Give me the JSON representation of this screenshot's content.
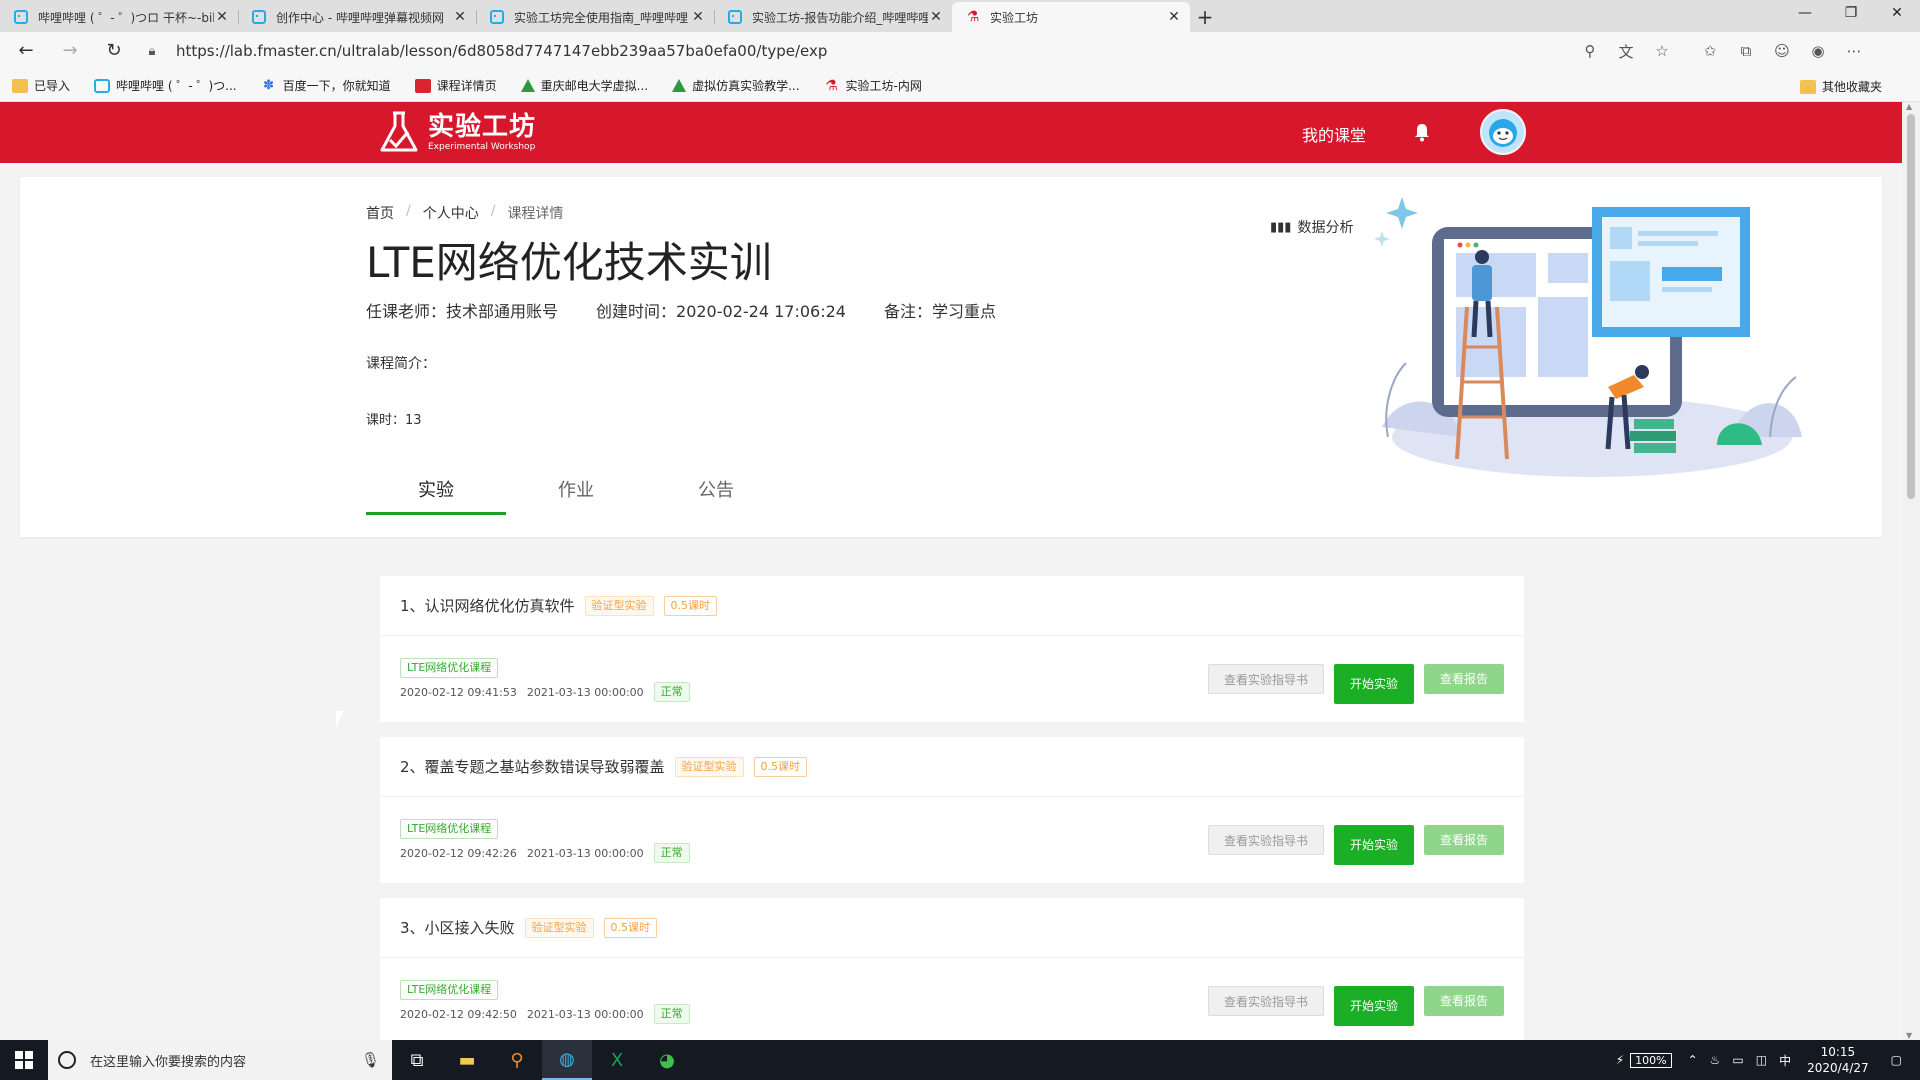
{
  "browser": {
    "tabs": [
      {
        "title": "哔哩哔哩 ( ゜- ゜)つロ 干杯~-bili",
        "icon": "bilibili-icon"
      },
      {
        "title": "创作中心 - 哔哩哔哩弹幕视频网",
        "icon": "bilibili-icon"
      },
      {
        "title": "实验工坊完全使用指南_哔哩哔哩",
        "icon": "bilibili-icon"
      },
      {
        "title": "实验工坊-报告功能介绍_哔哩哔哩",
        "icon": "bilibili-icon"
      },
      {
        "title": "实验工坊",
        "icon": "lab-icon"
      }
    ],
    "url": "https://lab.fmaster.cn/ultralab/lesson/6d8058d7747147ebb239aa57ba0efa00/type/exp",
    "bookmarks": [
      {
        "label": "已导入",
        "icon": "folder-icon"
      },
      {
        "label": "哔哩哔哩 ( ゜- ゜)つ...",
        "icon": "bilibili-icon"
      },
      {
        "label": "百度一下，你就知道",
        "icon": "baidu-icon"
      },
      {
        "label": "课程详情页",
        "icon": "red-app-icon"
      },
      {
        "label": "重庆邮电大学虚拟...",
        "icon": "triangle-icon"
      },
      {
        "label": "虚拟仿真实验教学...",
        "icon": "triangle-icon"
      },
      {
        "label": "实验工坊-内网",
        "icon": "lab-icon"
      }
    ],
    "other_bookmarks": "其他收藏夹"
  },
  "site": {
    "logo_cn": "实验工坊",
    "logo_en": "Experimental Workshop",
    "my_class": "我的课堂",
    "brand_color": "#d6172c"
  },
  "course": {
    "breadcrumb": [
      "首页",
      "个人中心",
      "课程详情"
    ],
    "title": "LTE网络优化技术实训",
    "teacher": "任课老师：技术部通用账号",
    "created": "创建时间：2020-02-24 17:06:24",
    "note": "备注：学习重点",
    "intro": "课程简介：",
    "hours": "课时：13",
    "analysis": "数据分析"
  },
  "tabs": [
    {
      "label": "实验",
      "active": true
    },
    {
      "label": "作业",
      "active": false
    },
    {
      "label": "公告",
      "active": false
    }
  ],
  "experiments": [
    {
      "title": "1、认识网络优化仿真软件",
      "type": "验证型实验",
      "hours": "0.5课时",
      "course_tag": "LTE网络优化课程",
      "start": "2020-02-12 09:41:53",
      "end": "2021-03-13 00:00:00",
      "status": "正常"
    },
    {
      "title": "2、覆盖专题之基站参数错误导致弱覆盖",
      "type": "验证型实验",
      "hours": "0.5课时",
      "course_tag": "LTE网络优化课程",
      "start": "2020-02-12 09:42:26",
      "end": "2021-03-13 00:00:00",
      "status": "正常"
    },
    {
      "title": "3、小区接入失败",
      "type": "验证型实验",
      "hours": "0.5课时",
      "course_tag": "LTE网络优化课程",
      "start": "2020-02-12 09:42:50",
      "end": "2021-03-13 00:00:00",
      "status": "正常"
    }
  ],
  "buttons": {
    "guide": "查看实验指导书",
    "start": "开始实验",
    "report": "查看报告"
  },
  "taskbar": {
    "search_placeholder": "在这里输入你要搜索的内容",
    "battery": "100%",
    "ime": "中",
    "time": "10:15",
    "date": "2020/4/27"
  }
}
